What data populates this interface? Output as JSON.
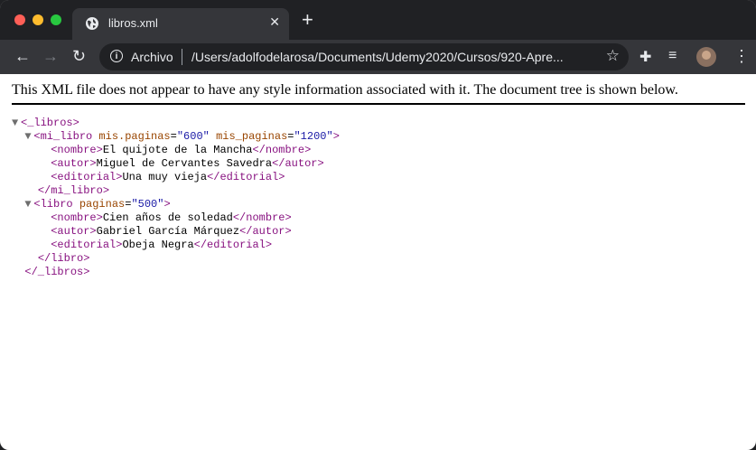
{
  "browser": {
    "tab_title": "libros.xml",
    "tab_close": "✕",
    "new_tab": "+",
    "back": "←",
    "forward": "→",
    "reload": "↻",
    "omnibox_label": "Archivo",
    "url": "/Users/adolfodelarosa/Documents/Udemy2020/Cursos/920-Apre...",
    "star": "☆",
    "extensions": "✚",
    "media": "≡",
    "menu": "⋮"
  },
  "page": {
    "info_message": "This XML file does not appear to have any style information associated with it. The document tree is shown below."
  },
  "xml": {
    "triangle": "▼",
    "root_open": "<_libros>",
    "root_close": "</_libros>",
    "mi_libro": {
      "open_start": "<mi_libro",
      "attr1_name": "mis.paginas",
      "attr1_value": "\"600\"",
      "attr2_name": "mis_paginas",
      "attr2_value": "\"1200\"",
      "open_end": ">",
      "close": "</mi_libro>",
      "nombre_open": "<nombre>",
      "nombre_text": "El quijote de la Mancha",
      "nombre_close": "</nombre>",
      "autor_open": "<autor>",
      "autor_text": "Miguel de Cervantes Savedra",
      "autor_close": "</autor>",
      "editorial_open": "<editorial>",
      "editorial_text": "Una muy vieja",
      "editorial_close": "</editorial>"
    },
    "libro": {
      "open_start": "<libro",
      "attr_name": "paginas",
      "attr_value": "\"500\"",
      "open_end": ">",
      "close": "</libro>",
      "nombre_open": "<nombre>",
      "nombre_text": "Cien años de soledad",
      "nombre_close": "</nombre>",
      "autor_open": "<autor>",
      "autor_text": "Gabriel García Márquez",
      "autor_close": "</autor>",
      "editorial_open": "<editorial>",
      "editorial_text": "Obeja Negra",
      "editorial_close": "</editorial>"
    }
  }
}
